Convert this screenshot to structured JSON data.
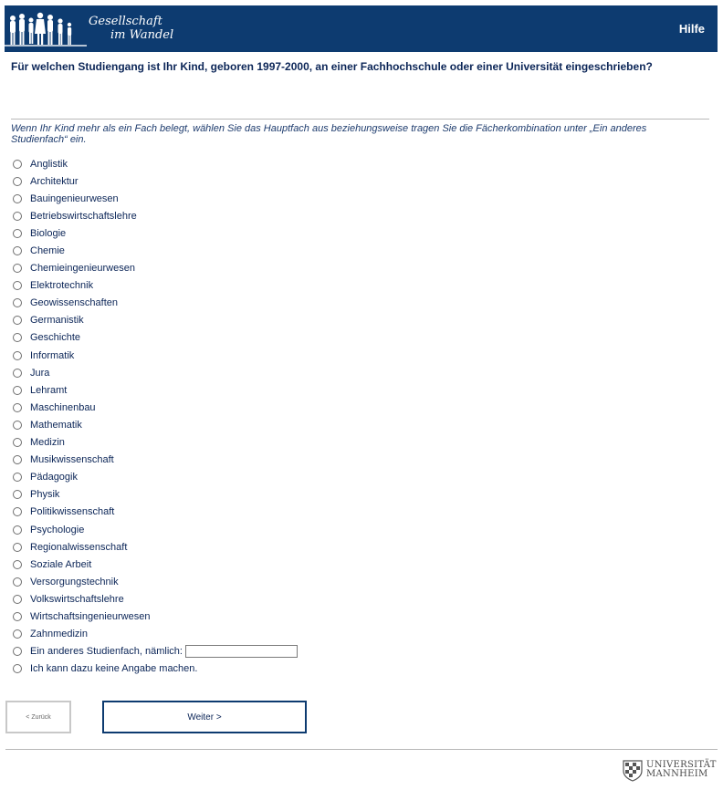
{
  "header": {
    "logo_line1": "Gesellschaft",
    "logo_line2": "im Wandel",
    "help_label": "Hilfe",
    "background_color": "#0d3b70"
  },
  "question": "Für welchen Studiengang ist Ihr Kind, geboren 1997-2000, an einer Fachhochschule oder einer Universität eingeschrieben?",
  "instruction": "Wenn Ihr Kind mehr als ein Fach belegt, wählen Sie das Hauptfach aus beziehungsweise tragen Sie die Fächerkombination unter „Ein anderes Studienfach“ ein.",
  "options": [
    "Anglistik",
    "Architektur",
    "Bauingenieurwesen",
    "Betriebswirtschaftslehre",
    "Biologie",
    "Chemie",
    "Chemieingenieurwesen",
    "Elektrotechnik",
    "Geowissenschaften",
    "Germanistik",
    "Geschichte",
    "Informatik",
    "Jura",
    "Lehramt",
    "Maschinenbau",
    "Mathematik",
    "Medizin",
    "Musikwissenschaft",
    "Pädagogik",
    "Physik",
    "Politikwissenschaft",
    "Psychologie",
    "Regionalwissenschaft",
    "Soziale Arbeit",
    "Versorgungstechnik",
    "Volkswirtschaftslehre",
    "Wirtschaftsingenieurwesen",
    "Zahnmedizin",
    "Ein anderes Studienfach, nämlich:",
    "Ich kann dazu keine Angabe machen."
  ],
  "other_input": {
    "value": "",
    "placeholder": ""
  },
  "buttons": {
    "back": "< Zurück",
    "next": "Weiter >"
  },
  "footer": {
    "university_line1": "UNIVERSITÄT",
    "university_line2": "MANNHEIM"
  }
}
